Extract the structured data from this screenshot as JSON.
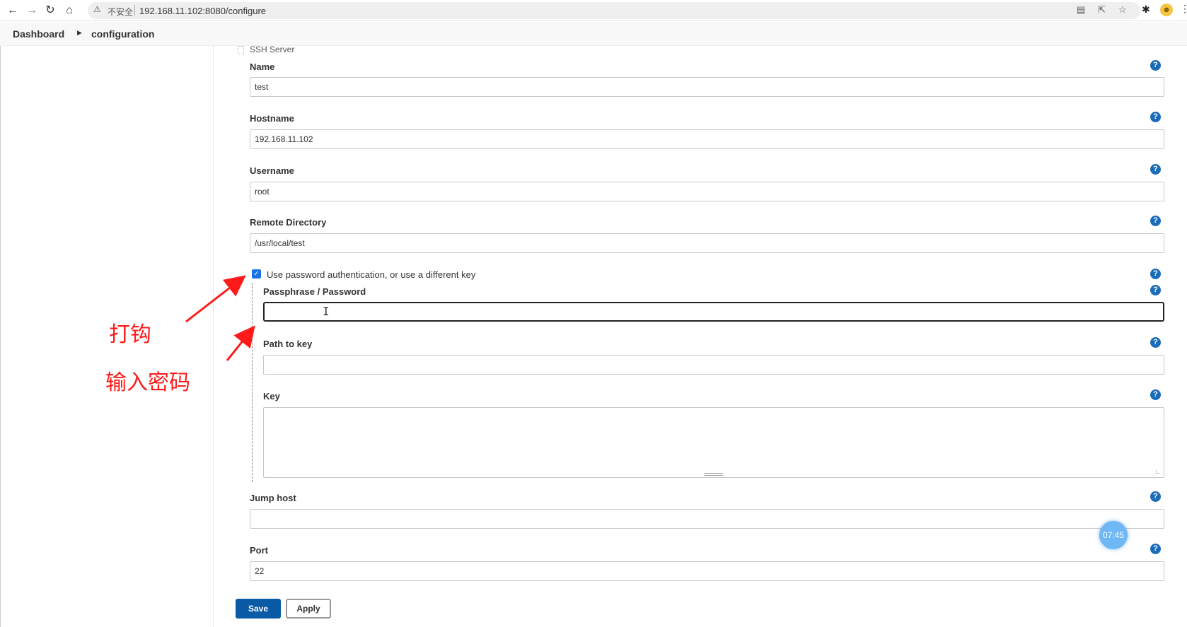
{
  "browser": {
    "security_label": "不安全",
    "url": "192.168.11.102:8080/configure"
  },
  "breadcrumb": {
    "items": [
      "Dashboard",
      "configuration"
    ]
  },
  "section": {
    "title": "SSH Server"
  },
  "form": {
    "name": {
      "label": "Name",
      "value": "test"
    },
    "hostname": {
      "label": "Hostname",
      "value": "192.168.11.102"
    },
    "username": {
      "label": "Username",
      "value": "root"
    },
    "remote_directory": {
      "label": "Remote Directory",
      "value": "/usr/local/test"
    },
    "use_password": {
      "label": "Use password authentication, or use a different key",
      "checked": true
    },
    "passphrase": {
      "label": "Passphrase / Password",
      "value": ""
    },
    "path_to_key": {
      "label": "Path to key",
      "value": ""
    },
    "key": {
      "label": "Key",
      "value": ""
    },
    "jump_host": {
      "label": "Jump host",
      "value": ""
    },
    "port": {
      "label": "Port",
      "value": "22"
    }
  },
  "buttons": {
    "save": "Save",
    "apply": "Apply"
  },
  "timer": "07:45",
  "annotations": {
    "check": "打钩",
    "enter_password": "输入密码"
  },
  "colors": {
    "primary": "#0b5aa5",
    "help": "#1a6bb8",
    "annotation": "#ff1a1a"
  }
}
